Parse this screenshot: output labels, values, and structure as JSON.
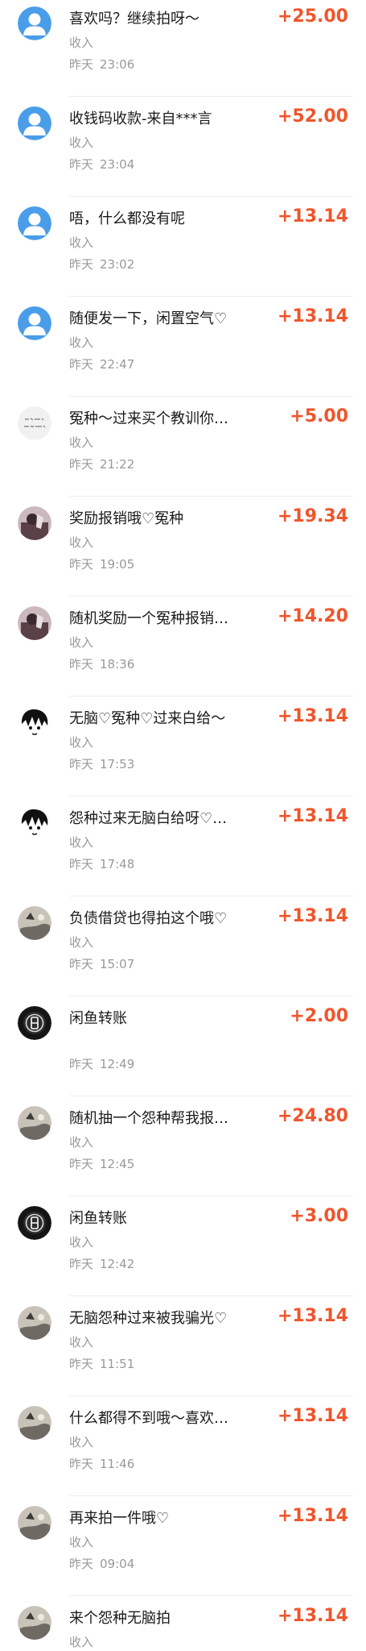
{
  "colors": {
    "amount": "#f0552c",
    "title": "#1a1a1a",
    "meta": "#999999",
    "divider": "#eeeeee",
    "default_avatar": "#4a9de8"
  },
  "transactions": [
    {
      "title": "喜欢吗？继续拍呀～",
      "type": "收入",
      "day": "昨天",
      "time": "23:06",
      "amount": "+25.00",
      "avatar": "default-user-icon"
    },
    {
      "title": "收钱码收款-来自***言",
      "type": "收入",
      "day": "昨天",
      "time": "23:04",
      "amount": "+52.00",
      "avatar": "default-user-icon"
    },
    {
      "title": "唔，什么都没有呢",
      "type": "收入",
      "day": "昨天",
      "time": "23:02",
      "amount": "+13.14",
      "avatar": "default-user-icon"
    },
    {
      "title": "随便发一下，闲置空气♡",
      "type": "收入",
      "day": "昨天",
      "time": "22:47",
      "amount": "+13.14",
      "avatar": "default-user-icon"
    },
    {
      "title": "冤种～过来买个教训你…",
      "type": "收入",
      "day": "昨天",
      "time": "21:22",
      "amount": "+5.00",
      "avatar": "handwriting-avatar"
    },
    {
      "title": "奖励报销哦♡冤种",
      "type": "收入",
      "day": "昨天",
      "time": "19:05",
      "amount": "+19.34",
      "avatar": "photo-avatar"
    },
    {
      "title": "随机奖励一个冤种报销…",
      "type": "收入",
      "day": "昨天",
      "time": "18:36",
      "amount": "+14.20",
      "avatar": "photo-avatar"
    },
    {
      "title": "无脑♡冤种♡过来白给～",
      "type": "收入",
      "day": "昨天",
      "time": "17:53",
      "amount": "+13.14",
      "avatar": "anime-avatar"
    },
    {
      "title": "怨种过来无脑白给呀♡…",
      "type": "收入",
      "day": "昨天",
      "time": "17:48",
      "amount": "+13.14",
      "avatar": "anime-avatar"
    },
    {
      "title": "负债借贷也得拍这个哦♡",
      "type": "收入",
      "day": "昨天",
      "time": "15:07",
      "amount": "+13.14",
      "avatar": "sketch-avatar"
    },
    {
      "title": "闲鱼转账",
      "type": "",
      "day": "昨天",
      "time": "12:49",
      "amount": "+2.00",
      "avatar": "xianyu-avatar"
    },
    {
      "title": "随机抽一个怨种帮我报…",
      "type": "收入",
      "day": "昨天",
      "time": "12:45",
      "amount": "+24.80",
      "avatar": "sketch-avatar"
    },
    {
      "title": "闲鱼转账",
      "type": "收入",
      "day": "昨天",
      "time": "12:42",
      "amount": "+3.00",
      "avatar": "xianyu-avatar"
    },
    {
      "title": "无脑怨种过来被我骗光♡",
      "type": "收入",
      "day": "昨天",
      "time": "11:51",
      "amount": "+13.14",
      "avatar": "sketch-avatar"
    },
    {
      "title": "什么都得不到哦～喜欢…",
      "type": "收入",
      "day": "昨天",
      "time": "11:46",
      "amount": "+13.14",
      "avatar": "sketch-avatar"
    },
    {
      "title": "再来拍一件哦♡",
      "type": "收入",
      "day": "昨天",
      "time": "09:04",
      "amount": "+13.14",
      "avatar": "sketch-avatar"
    },
    {
      "title": "来个怨种无脑拍",
      "type": "收入",
      "day": "",
      "time": "",
      "amount": "+13.14",
      "avatar": "sketch-avatar"
    }
  ]
}
